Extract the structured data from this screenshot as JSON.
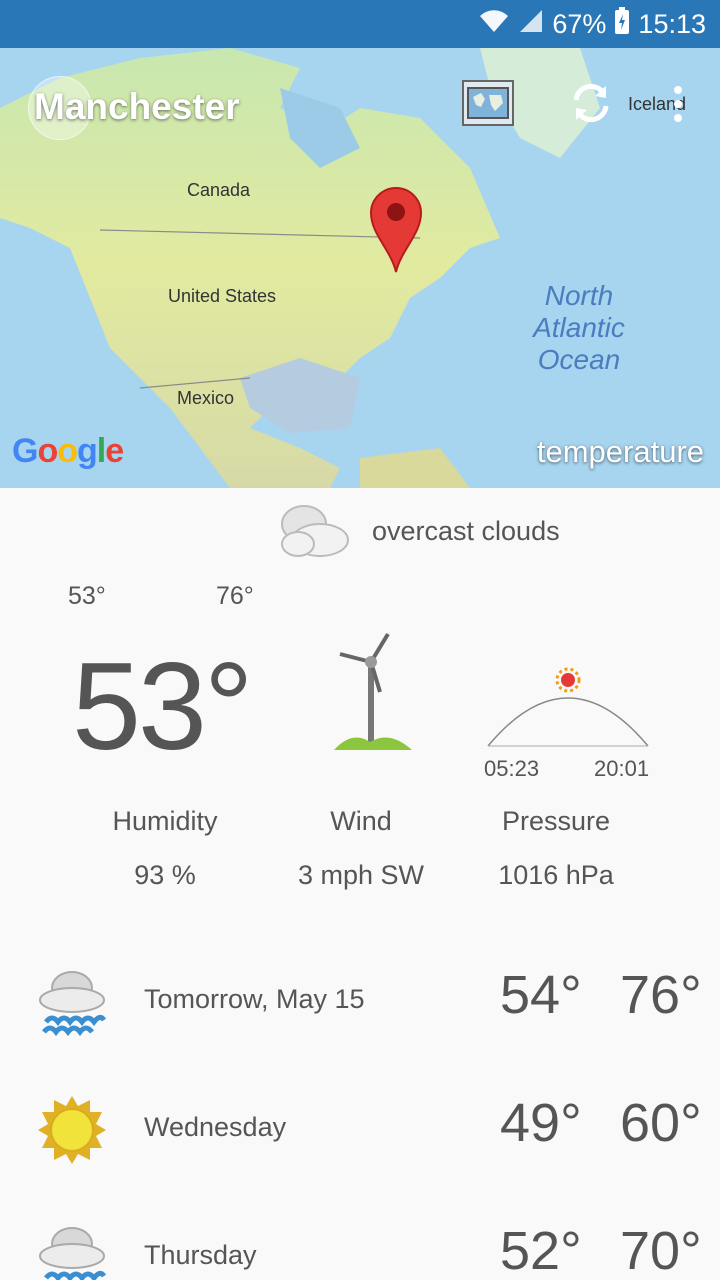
{
  "status_bar": {
    "battery": "67%",
    "time": "15:13"
  },
  "map": {
    "city": "Manchester",
    "labels": {
      "canada": "Canada",
      "united_states": "United States",
      "mexico": "Mexico",
      "iceland": "Iceland",
      "ocean": "North Atlantic Ocean"
    },
    "google": "Google",
    "layer": "temperature"
  },
  "current": {
    "condition": "overcast clouds",
    "min": "53°",
    "max": "76°",
    "temperature": "53°",
    "sunrise": "05:23",
    "sunset": "20:01",
    "stats": {
      "humidity_label": "Humidity",
      "humidity_value": "93 %",
      "wind_label": "Wind",
      "wind_value": "3 mph SW",
      "pressure_label": "Pressure",
      "pressure_value": "1016 hPa"
    }
  },
  "forecast": [
    {
      "day": "Tomorrow, May 15",
      "icon": "rain-cloud-icon",
      "low": "54°",
      "high": "76°"
    },
    {
      "day": "Wednesday",
      "icon": "sun-icon",
      "low": "49°",
      "high": "60°"
    },
    {
      "day": "Thursday",
      "icon": "rain-cloud-icon",
      "low": "52°",
      "high": "70°"
    }
  ],
  "colors": {
    "status_bar": "#2a77b8",
    "pin": "#e53935",
    "wind_green": "#8cc63f",
    "sun": "#f4d03f"
  }
}
